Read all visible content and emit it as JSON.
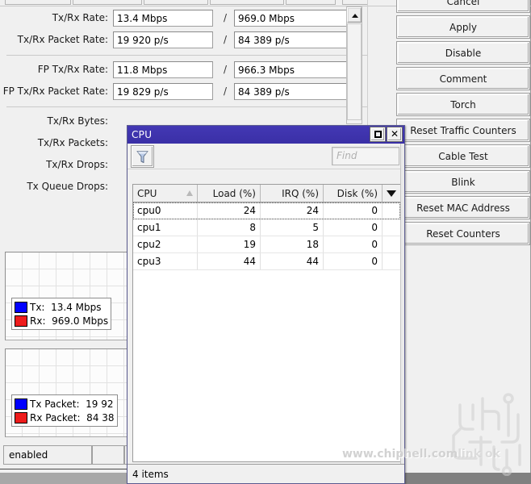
{
  "interface_dialog": {
    "fields": [
      {
        "label": "Tx/Rx Rate:",
        "value_tx": "13.4 Mbps",
        "value_rx": "969.0 Mbps",
        "separator": "/"
      },
      {
        "label": "Tx/Rx Packet Rate:",
        "value_tx": "19 920 p/s",
        "value_rx": "84 389 p/s",
        "separator": "/"
      },
      {
        "label": "FP Tx/Rx Rate:",
        "value_tx": "11.8 Mbps",
        "value_rx": "966.3 Mbps",
        "separator": "/"
      },
      {
        "label": "FP Tx/Rx Packet Rate:",
        "value_tx": "19 829 p/s",
        "value_rx": "84 389 p/s",
        "separator": "/"
      }
    ],
    "occluded_labels": [
      {
        "label": "Tx/Rx Bytes:"
      },
      {
        "label": "Tx/Rx Packets:"
      },
      {
        "label": "Tx/Rx Drops:"
      },
      {
        "label": "Tx Queue Drops:"
      }
    ],
    "graphs": [
      {
        "name": "rate-graph",
        "legend": [
          {
            "color": "#0000ff",
            "text": "Tx:  13.4 Mbps"
          },
          {
            "color": "#ee1c1c",
            "text": "Rx:  969.0 Mbps"
          }
        ]
      },
      {
        "name": "packet-rate-graph",
        "legend": [
          {
            "color": "#0000ff",
            "text": "Tx Packet:  19 92"
          },
          {
            "color": "#ee1c1c",
            "text": "Rx Packet:  84 38"
          }
        ]
      }
    ],
    "status_fields": {
      "state": "enabled",
      "second": "",
      "third": ""
    },
    "scrollbar": {
      "up_arrow": "scroll-up-arrow"
    }
  },
  "buttons": [
    {
      "label": "Cancel"
    },
    {
      "label": "Apply"
    },
    {
      "label": "Disable"
    },
    {
      "label": "Comment"
    },
    {
      "label": "Torch"
    },
    {
      "label": "Reset Traffic Counters"
    },
    {
      "label": "Cable Test"
    },
    {
      "label": "Blink"
    },
    {
      "label": "Reset MAC Address"
    },
    {
      "label": "Reset Counters"
    }
  ],
  "cpu_window": {
    "title": "CPU",
    "titlebar_color": "#3b2fa8",
    "maximize_label": "□",
    "close_label": "✕",
    "toolbar": {
      "filter_icon": "funnel-icon",
      "find_placeholder": "Find"
    },
    "table": {
      "columns": [
        "CPU",
        "Load (%)",
        "IRQ (%)",
        "Disk (%)"
      ],
      "sorted_column": "CPU",
      "rows": [
        {
          "cpu": "cpu0",
          "load": "24",
          "irq": "24",
          "disk": "0"
        },
        {
          "cpu": "cpu1",
          "load": "8",
          "irq": "5",
          "disk": "0"
        },
        {
          "cpu": "cpu2",
          "load": "19",
          "irq": "18",
          "disk": "0"
        },
        {
          "cpu": "cpu3",
          "load": "44",
          "irq": "44",
          "disk": "0"
        }
      ]
    },
    "status": "4 items"
  },
  "watermark": {
    "url": "www.chiphell.com",
    "extra": "link ok",
    "logo": "chiphell-logo"
  }
}
